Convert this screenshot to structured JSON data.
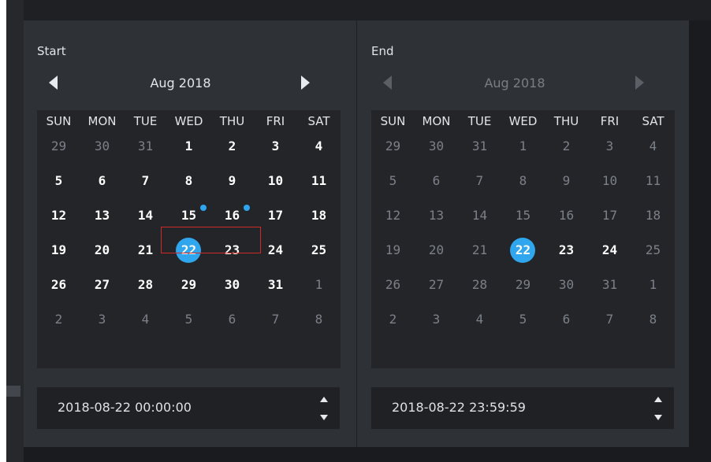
{
  "start": {
    "title": "Start",
    "month_label": "Aug 2018",
    "weekdays": [
      "SUN",
      "MON",
      "TUE",
      "WED",
      "THU",
      "FRI",
      "SAT"
    ],
    "weeks": [
      [
        {
          "d": "29",
          "s": "dim"
        },
        {
          "d": "30",
          "s": "dim"
        },
        {
          "d": "31",
          "s": "dim"
        },
        {
          "d": "1",
          "s": "cur"
        },
        {
          "d": "2",
          "s": "cur"
        },
        {
          "d": "3",
          "s": "cur"
        },
        {
          "d": "4",
          "s": "cur"
        }
      ],
      [
        {
          "d": "5",
          "s": "cur"
        },
        {
          "d": "6",
          "s": "cur"
        },
        {
          "d": "7",
          "s": "cur"
        },
        {
          "d": "8",
          "s": "cur"
        },
        {
          "d": "9",
          "s": "cur"
        },
        {
          "d": "10",
          "s": "cur"
        },
        {
          "d": "11",
          "s": "cur"
        }
      ],
      [
        {
          "d": "12",
          "s": "cur"
        },
        {
          "d": "13",
          "s": "cur"
        },
        {
          "d": "14",
          "s": "cur"
        },
        {
          "d": "15",
          "s": "cur",
          "dot": true
        },
        {
          "d": "16",
          "s": "cur",
          "dot": true
        },
        {
          "d": "17",
          "s": "cur"
        },
        {
          "d": "18",
          "s": "cur"
        }
      ],
      [
        {
          "d": "19",
          "s": "cur"
        },
        {
          "d": "20",
          "s": "cur"
        },
        {
          "d": "21",
          "s": "cur"
        },
        {
          "d": "22",
          "s": "sel"
        },
        {
          "d": "23",
          "s": "cur"
        },
        {
          "d": "24",
          "s": "cur"
        },
        {
          "d": "25",
          "s": "cur"
        }
      ],
      [
        {
          "d": "26",
          "s": "cur"
        },
        {
          "d": "27",
          "s": "cur"
        },
        {
          "d": "28",
          "s": "cur"
        },
        {
          "d": "29",
          "s": "cur"
        },
        {
          "d": "30",
          "s": "cur"
        },
        {
          "d": "31",
          "s": "cur"
        },
        {
          "d": "1",
          "s": "dim"
        }
      ],
      [
        {
          "d": "2",
          "s": "dim"
        },
        {
          "d": "3",
          "s": "dim"
        },
        {
          "d": "4",
          "s": "dim"
        },
        {
          "d": "5",
          "s": "dim"
        },
        {
          "d": "6",
          "s": "dim"
        },
        {
          "d": "7",
          "s": "dim"
        },
        {
          "d": "8",
          "s": "dim"
        }
      ]
    ],
    "time_value": "2018-08-22 00:00:00"
  },
  "end": {
    "title": "End",
    "month_label": "Aug 2018",
    "weekdays": [
      "SUN",
      "MON",
      "TUE",
      "WED",
      "THU",
      "FRI",
      "SAT"
    ],
    "weeks": [
      [
        {
          "d": "29",
          "s": "dim"
        },
        {
          "d": "30",
          "s": "dim"
        },
        {
          "d": "31",
          "s": "dim"
        },
        {
          "d": "1",
          "s": "dim"
        },
        {
          "d": "2",
          "s": "dim"
        },
        {
          "d": "3",
          "s": "dim"
        },
        {
          "d": "4",
          "s": "dim"
        }
      ],
      [
        {
          "d": "5",
          "s": "dim"
        },
        {
          "d": "6",
          "s": "dim"
        },
        {
          "d": "7",
          "s": "dim"
        },
        {
          "d": "8",
          "s": "dim"
        },
        {
          "d": "9",
          "s": "dim"
        },
        {
          "d": "10",
          "s": "dim"
        },
        {
          "d": "11",
          "s": "dim"
        }
      ],
      [
        {
          "d": "12",
          "s": "dim"
        },
        {
          "d": "13",
          "s": "dim"
        },
        {
          "d": "14",
          "s": "dim"
        },
        {
          "d": "15",
          "s": "dim"
        },
        {
          "d": "16",
          "s": "dim"
        },
        {
          "d": "17",
          "s": "dim"
        },
        {
          "d": "18",
          "s": "dim"
        }
      ],
      [
        {
          "d": "19",
          "s": "dim"
        },
        {
          "d": "20",
          "s": "dim"
        },
        {
          "d": "21",
          "s": "dim"
        },
        {
          "d": "22",
          "s": "sel"
        },
        {
          "d": "23",
          "s": "cur"
        },
        {
          "d": "24",
          "s": "cur"
        },
        {
          "d": "25",
          "s": "dim"
        }
      ],
      [
        {
          "d": "26",
          "s": "dim"
        },
        {
          "d": "27",
          "s": "dim"
        },
        {
          "d": "28",
          "s": "dim"
        },
        {
          "d": "29",
          "s": "dim"
        },
        {
          "d": "30",
          "s": "dim"
        },
        {
          "d": "31",
          "s": "dim"
        },
        {
          "d": "1",
          "s": "dim"
        }
      ],
      [
        {
          "d": "2",
          "s": "dim"
        },
        {
          "d": "3",
          "s": "dim"
        },
        {
          "d": "4",
          "s": "dim"
        },
        {
          "d": "5",
          "s": "dim"
        },
        {
          "d": "6",
          "s": "dim"
        },
        {
          "d": "7",
          "s": "dim"
        },
        {
          "d": "8",
          "s": "dim"
        }
      ]
    ],
    "time_value": "2018-08-22 23:59:59"
  },
  "icons": {
    "prev": "triangle-left-icon",
    "next": "triangle-right-icon",
    "spin_up": "triangle-up-icon",
    "spin_down": "triangle-down-icon"
  },
  "colors": {
    "accent": "#2fa6ee",
    "highlight_border": "#cf2a25",
    "panel_bg": "#2e3135",
    "grid_bg": "#232528",
    "text_current": "#ffffff",
    "text_dim": "#7c8088"
  }
}
